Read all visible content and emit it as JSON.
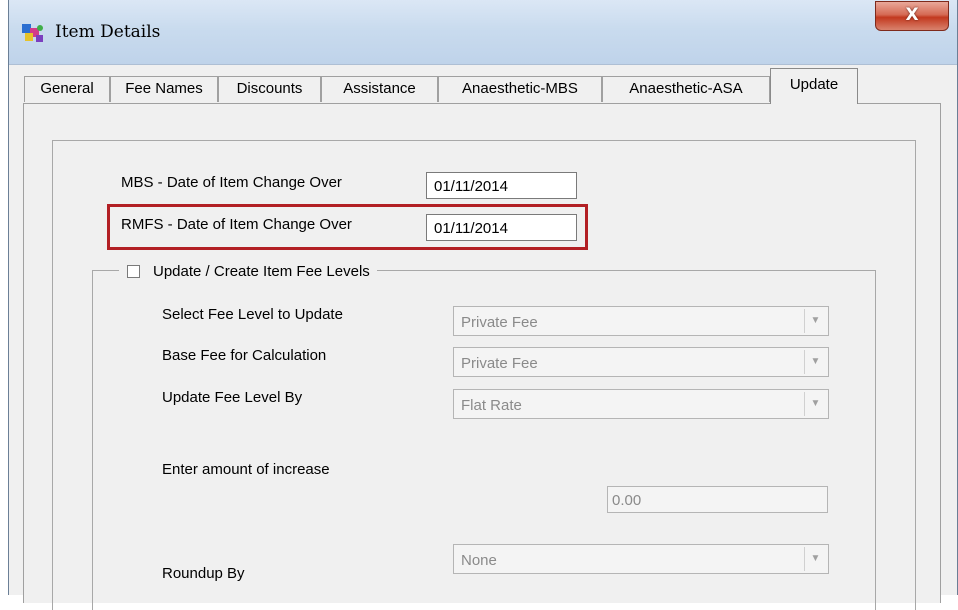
{
  "window": {
    "title": "Item Details",
    "close_label": "X"
  },
  "tabs": [
    {
      "label": "General"
    },
    {
      "label": "Fee Names"
    },
    {
      "label": "Discounts"
    },
    {
      "label": "Assistance"
    },
    {
      "label": "Anaesthetic-MBS"
    },
    {
      "label": "Anaesthetic-ASA"
    },
    {
      "label": "Update",
      "active": true
    }
  ],
  "form": {
    "mbs_label": "MBS - Date of Item Change Over",
    "mbs_value": "01/11/2014",
    "rmfs_label": "RMFS - Date of Item Change Over",
    "rmfs_value": "01/11/2014",
    "update_group_label": "Update / Create Item Fee Levels",
    "update_checked": false,
    "select_fee_level_label": "Select Fee Level to Update",
    "select_fee_level_value": "Private Fee",
    "base_fee_label": "Base Fee for Calculation",
    "base_fee_value": "Private Fee",
    "update_by_label": "Update Fee Level By",
    "update_by_value": "Flat Rate",
    "amount_label": "Enter amount of increase",
    "amount_value": "0.00",
    "roundup_label": "Roundup By",
    "roundup_value": "None"
  },
  "colors": {
    "highlight": "#b21f24",
    "close_button": "#c2391f"
  },
  "icons": {
    "app": "item-details-app-icon",
    "close": "close-icon",
    "dropdown": "chevron-down-icon"
  }
}
